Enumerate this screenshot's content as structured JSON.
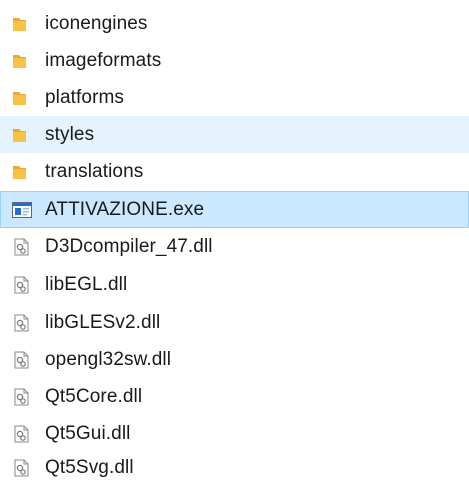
{
  "window": {
    "view": "file-list"
  },
  "colors": {
    "folder": "#f6c344",
    "selected_bg": "#cce8ff",
    "selected_border": "#99d1ff",
    "hover_bg": "#e5f3ff",
    "exe_accent": "#1f6fd0"
  },
  "files": {
    "items": [
      {
        "name": "iconengines",
        "type": "folder",
        "icon": "folder-icon",
        "state": "normal"
      },
      {
        "name": "imageformats",
        "type": "folder",
        "icon": "folder-icon",
        "state": "normal"
      },
      {
        "name": "platforms",
        "type": "folder",
        "icon": "folder-icon",
        "state": "normal"
      },
      {
        "name": "styles",
        "type": "folder",
        "icon": "folder-icon",
        "state": "hover"
      },
      {
        "name": "translations",
        "type": "folder",
        "icon": "folder-icon",
        "state": "normal"
      },
      {
        "name": "ATTIVAZIONE.exe",
        "type": "executable",
        "icon": "application-icon",
        "state": "selected"
      },
      {
        "name": "D3Dcompiler_47.dll",
        "type": "dll",
        "icon": "dll-icon",
        "state": "normal"
      },
      {
        "name": "libEGL.dll",
        "type": "dll",
        "icon": "dll-icon",
        "state": "normal"
      },
      {
        "name": "libGLESv2.dll",
        "type": "dll",
        "icon": "dll-icon",
        "state": "normal"
      },
      {
        "name": "opengl32sw.dll",
        "type": "dll",
        "icon": "dll-icon",
        "state": "normal"
      },
      {
        "name": "Qt5Core.dll",
        "type": "dll",
        "icon": "dll-icon",
        "state": "normal"
      },
      {
        "name": "Qt5Gui.dll",
        "type": "dll",
        "icon": "dll-icon",
        "state": "normal"
      },
      {
        "name": "Qt5Svg.dll",
        "type": "dll",
        "icon": "dll-icon",
        "state": "normal"
      }
    ]
  }
}
